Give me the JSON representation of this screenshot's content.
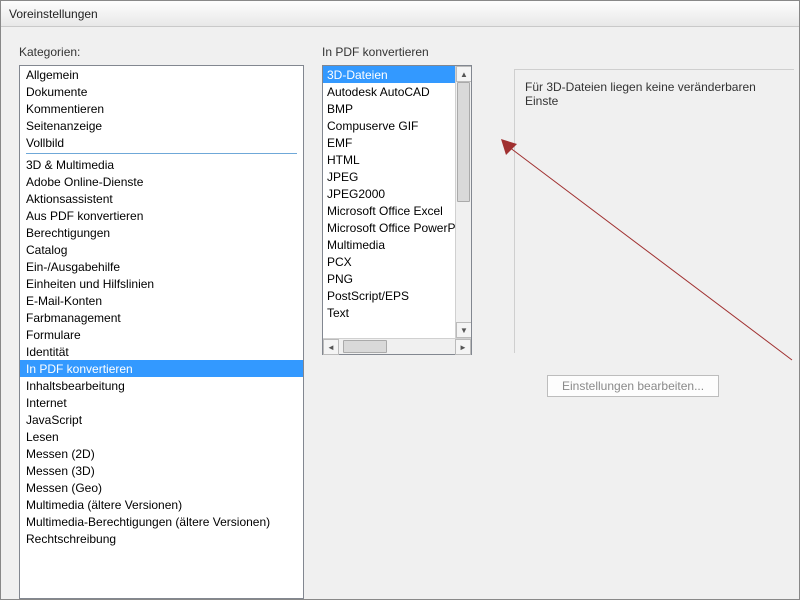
{
  "window": {
    "title": "Voreinstellungen"
  },
  "left": {
    "label": "Kategorien:",
    "group1": [
      "Allgemein",
      "Dokumente",
      "Kommentieren",
      "Seitenanzeige",
      "Vollbild"
    ],
    "group2": [
      "3D & Multimedia",
      "Adobe Online-Dienste",
      "Aktionsassistent",
      "Aus PDF konvertieren",
      "Berechtigungen",
      "Catalog",
      "Ein-/Ausgabehilfe",
      "Einheiten und Hilfslinien",
      "E-Mail-Konten",
      "Farbmanagement",
      "Formulare",
      "Identität",
      "In PDF konvertieren",
      "Inhaltsbearbeitung",
      "Internet",
      "JavaScript",
      "Lesen",
      "Messen (2D)",
      "Messen (3D)",
      "Messen (Geo)",
      "Multimedia (ältere Versionen)",
      "Multimedia-Berechtigungen (ältere Versionen)",
      "Rechtschreibung"
    ],
    "selected": "In PDF konvertieren"
  },
  "right": {
    "label": "In PDF konvertieren",
    "formats": [
      "3D-Dateien",
      "Autodesk AutoCAD",
      "BMP",
      "Compuserve GIF",
      "EMF",
      "HTML",
      "JPEG",
      "JPEG2000",
      "Microsoft Office Excel",
      "Microsoft Office PowerPoint",
      "Multimedia",
      "PCX",
      "PNG",
      "PostScript/EPS",
      "Text"
    ],
    "selected_format": "3D-Dateien",
    "message": "Für 3D-Dateien liegen keine veränderbaren Einste",
    "edit_button": "Einstellungen bearbeiten..."
  }
}
